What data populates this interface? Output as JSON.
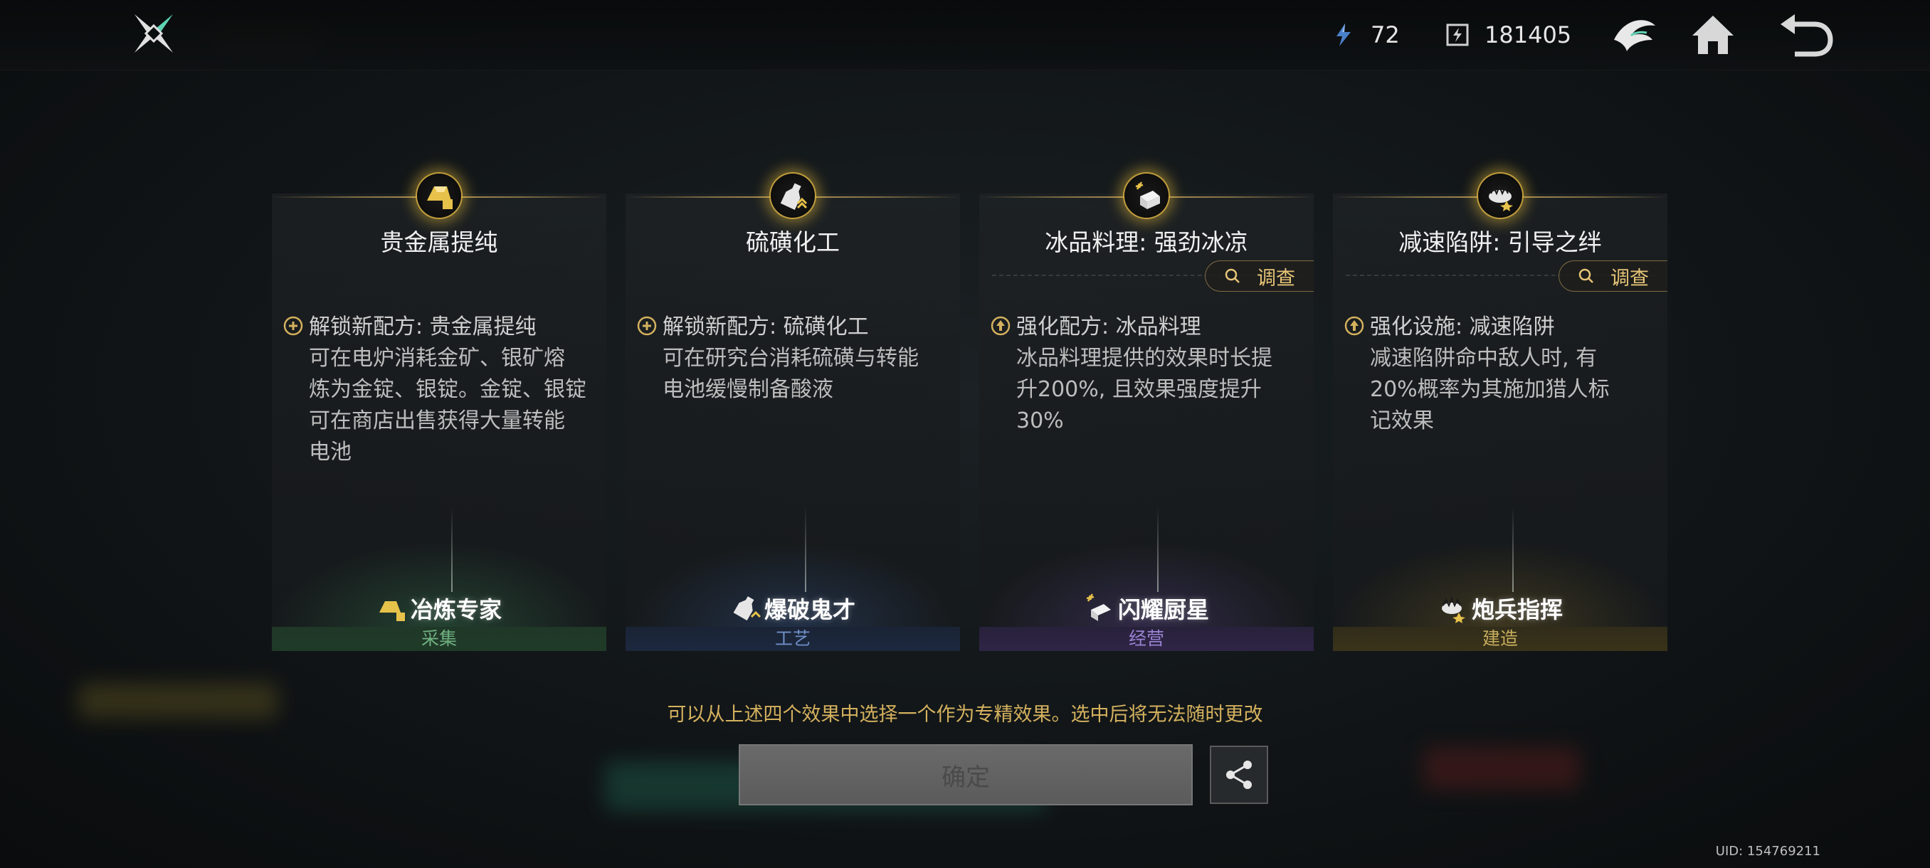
{
  "topbar": {
    "energy": "72",
    "chips": "181405"
  },
  "cards": [
    {
      "title": "贵金属提纯",
      "effect_head": "解锁新配方: 贵金属提纯",
      "effect_body": [
        "可在电炉消耗金矿、银矿熔",
        "炼为金锭、银锭。金锭、银锭",
        "可在商店出售获得大量转能",
        "电池"
      ],
      "talent": "冶炼专家",
      "category": "采集",
      "investigate": ""
    },
    {
      "title": "硫磺化工",
      "effect_head": "解锁新配方: 硫磺化工",
      "effect_body": [
        "可在研究台消耗硫磺与转能",
        "电池缓慢制备酸液"
      ],
      "talent": "爆破鬼才",
      "category": "工艺",
      "investigate": ""
    },
    {
      "title": "冰品料理: 强劲冰凉",
      "effect_head": "强化配方: 冰品料理",
      "effect_body": [
        "冰品料理提供的效果时长提",
        "升200%, 且效果强度提升",
        "30%"
      ],
      "talent": "闪耀厨星",
      "category": "经营",
      "investigate": "调查"
    },
    {
      "title": "减速陷阱: 引导之绊",
      "effect_head": "强化设施: 减速陷阱",
      "effect_body": [
        "减速陷阱命中敌人时, 有",
        "20%概率为其施加猎人标",
        "记效果"
      ],
      "talent": "炮兵指挥",
      "category": "建造",
      "investigate": "调查"
    }
  ],
  "notice": "可以从上述四个效果中选择一个作为专精效果。选中后将无法随时更改",
  "confirm_label": "确定",
  "uid": "UID: 154769211",
  "icons": {
    "logo": "crossed-blades-logo-icon",
    "energy": "energy-crystal-icon",
    "chips": "chip-currency-icon",
    "emblem": "faction-emblem-icon",
    "home": "home-icon",
    "back": "back-arrow-icon",
    "share": "share-icon"
  },
  "colors": {
    "gold_text": "#d4b15e",
    "category_green": "#6fb181",
    "category_blue": "#6f8fc8",
    "category_purple": "#9a83d3",
    "category_gold": "#c7ad5d"
  }
}
